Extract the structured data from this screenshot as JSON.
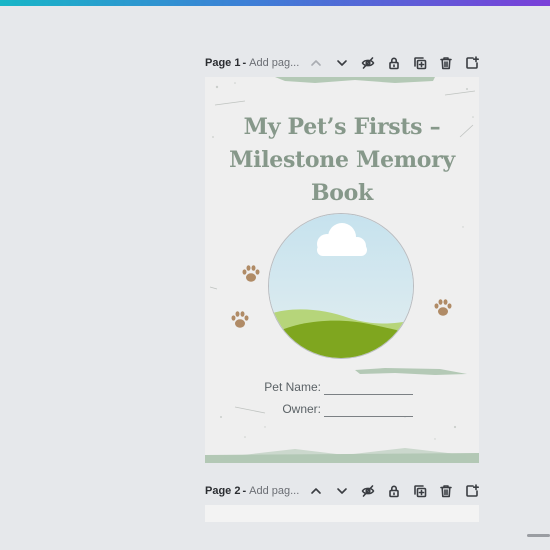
{
  "pages": [
    {
      "number": "Page 1",
      "title_placeholder": "Add pag..."
    },
    {
      "number": "Page 2",
      "title_placeholder": "Add pag..."
    }
  ],
  "toolbar_icons": [
    "chevron-up-icon",
    "chevron-down-icon",
    "eye-hide-icon",
    "lock-icon",
    "duplicate-icon",
    "trash-icon",
    "add-page-icon"
  ],
  "book": {
    "title_lines": [
      "My Pet’s Firsts –",
      "Milestone Memory",
      "Book"
    ],
    "pet_name_label": "Pet Name:",
    "owner_label": "Owner:"
  },
  "colors": {
    "title": "#86988a",
    "accent_gradient": [
      "#18b6c7",
      "#7a3fd8"
    ],
    "paw": "#b08b66",
    "grass": "#7fa61f",
    "sky": "#c9e3ef"
  }
}
